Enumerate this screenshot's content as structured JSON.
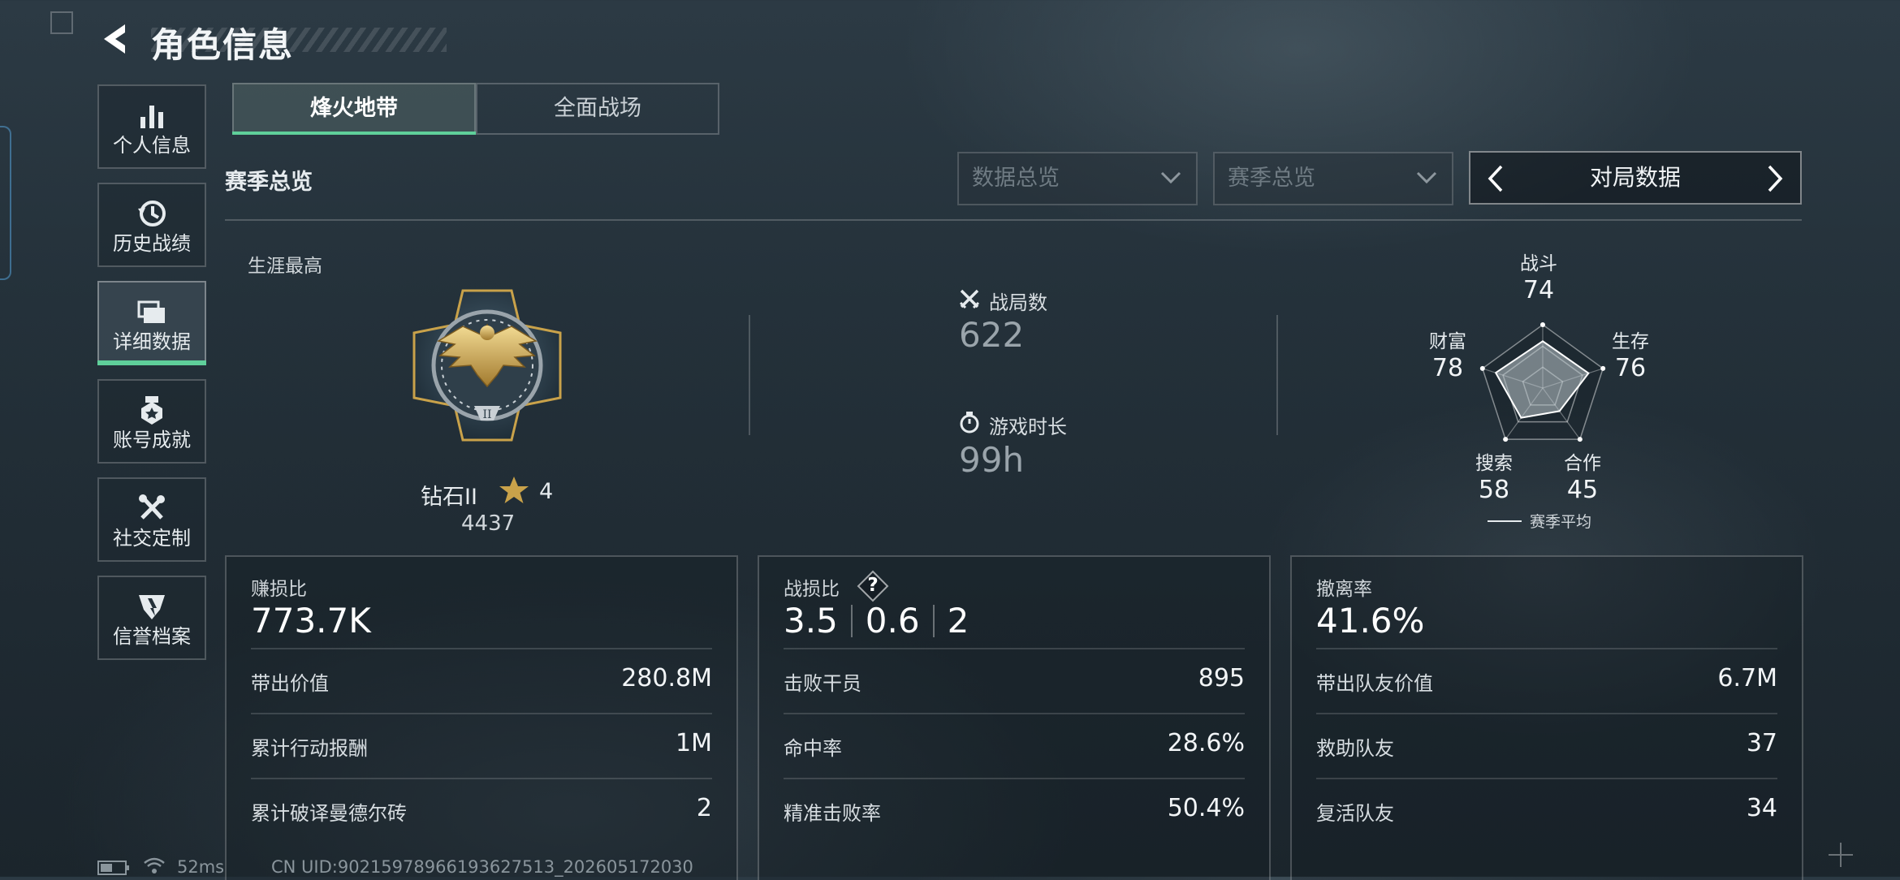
{
  "header": {
    "title": "角色信息"
  },
  "sidebar": {
    "items": [
      {
        "label": "个人信息",
        "icon": "bar-chart-icon"
      },
      {
        "label": "历史战绩",
        "icon": "history-clock-icon"
      },
      {
        "label": "详细数据",
        "icon": "folder-icon",
        "active": true
      },
      {
        "label": "账号成就",
        "icon": "medal-icon"
      },
      {
        "label": "社交定制",
        "icon": "tools-icon"
      },
      {
        "label": "信誉档案",
        "icon": "shield-emblem-icon"
      }
    ]
  },
  "tabs": [
    {
      "label": "烽火地带",
      "active": true
    },
    {
      "label": "全面战场",
      "active": false
    }
  ],
  "section_title": "赛季总览",
  "filters": {
    "data_dropdown": "数据总览",
    "season_dropdown": "赛季总览",
    "pager_label": "对局数据"
  },
  "career": {
    "label": "生涯最高",
    "rank_name": "钻石II",
    "rank_stars": "4",
    "rank_score": "4437"
  },
  "matches": {
    "label": "战局数",
    "value": "622"
  },
  "playtime": {
    "label": "游戏时长",
    "value": "99h"
  },
  "radar": {
    "stats": [
      {
        "name": "战斗",
        "value": 74
      },
      {
        "name": "生存",
        "value": 76
      },
      {
        "name": "合作",
        "value": 45
      },
      {
        "name": "搜索",
        "value": 58
      },
      {
        "name": "财富",
        "value": 78
      }
    ],
    "legend": "赛季平均"
  },
  "cards": [
    {
      "title": "赚损比",
      "big": "773.7K",
      "rows": [
        {
          "label": "带出价值",
          "value": "280.8M"
        },
        {
          "label": "累计行动报酬",
          "value": "1M"
        },
        {
          "label": "累计破译曼德尔砖",
          "value": "2"
        }
      ]
    },
    {
      "title": "战损比",
      "help": "?",
      "kd": [
        "3.5",
        "0.6",
        "2"
      ],
      "rows": [
        {
          "label": "击败干员",
          "value": "895"
        },
        {
          "label": "命中率",
          "value": "28.6%"
        },
        {
          "label": "精准击败率",
          "value": "50.4%"
        }
      ]
    },
    {
      "title": "撤离率",
      "big": "41.6%",
      "rows": [
        {
          "label": "带出队友价值",
          "value": "6.7M"
        },
        {
          "label": "救助队友",
          "value": "37"
        },
        {
          "label": "复活队友",
          "value": "34"
        }
      ]
    }
  ],
  "footer": {
    "ping": "52ms",
    "uid": "CN UID:9021597896619362751​3_202605172030"
  },
  "colors": {
    "accent": "#5fcf9a",
    "gold": "#c9a24a"
  }
}
